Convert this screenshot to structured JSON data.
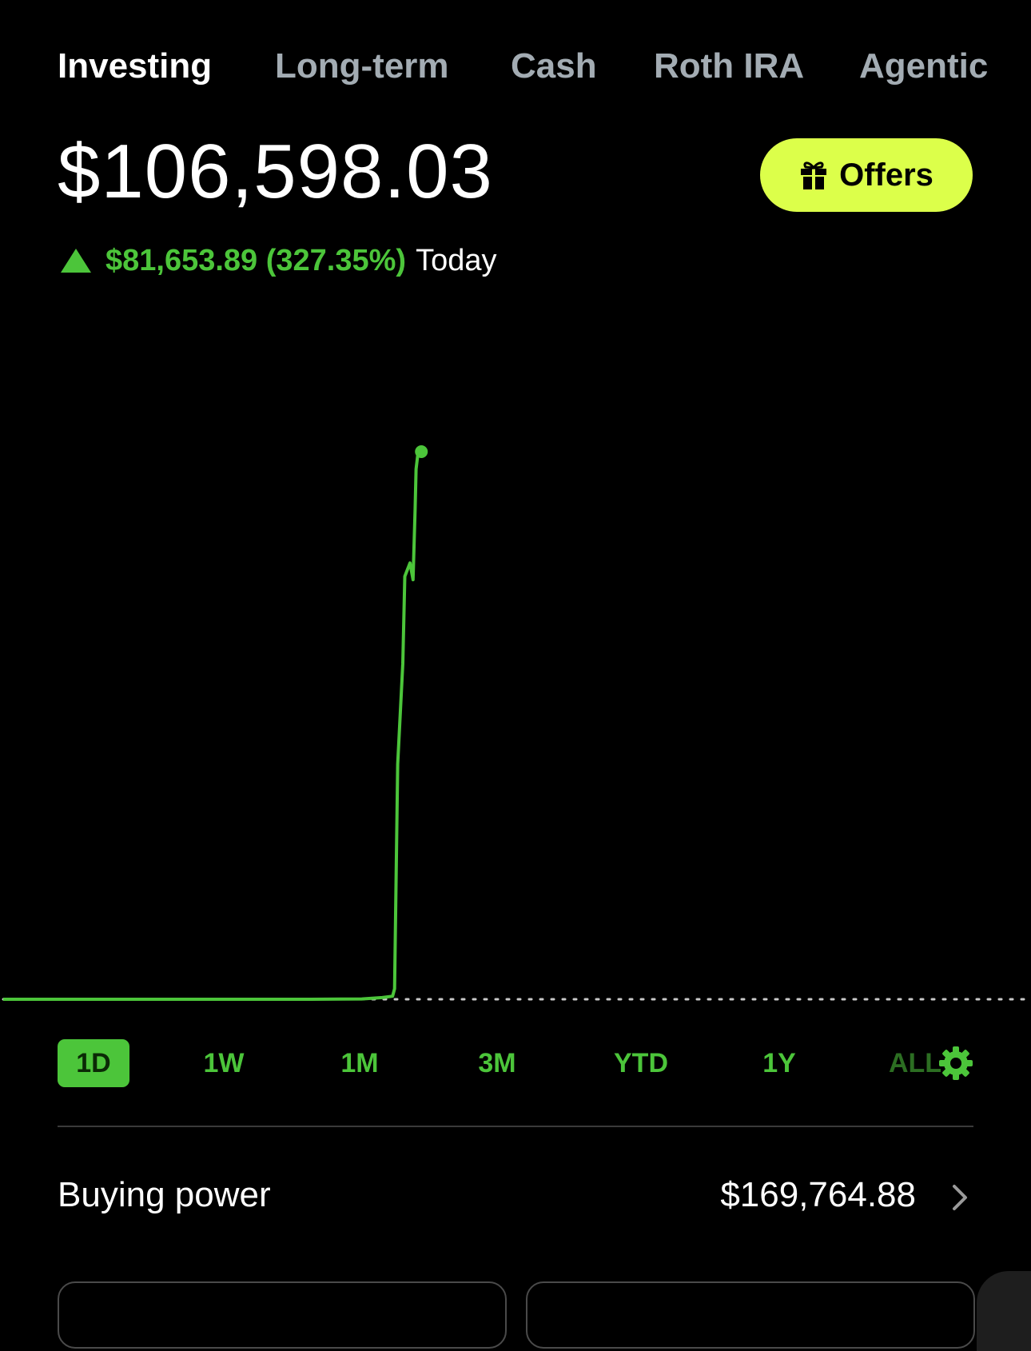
{
  "tabs": [
    {
      "label": "Investing",
      "active": true
    },
    {
      "label": "Long-term",
      "active": false
    },
    {
      "label": "Cash",
      "active": false
    },
    {
      "label": "Roth IRA",
      "active": false
    },
    {
      "label": "Agentic",
      "active": false
    }
  ],
  "portfolio": {
    "value": "$106,598.03",
    "change": "$81,653.89 (327.35%)",
    "period": "Today"
  },
  "offers_button": {
    "label": "Offers",
    "icon": "gift-icon",
    "color": "#dcff4a"
  },
  "colors": {
    "positive": "#4cc53a",
    "background": "#000000"
  },
  "chart_data": {
    "type": "line",
    "series": [
      {
        "x": [
          0,
          0.05,
          0.1,
          0.15,
          0.2,
          0.25,
          0.3,
          0.33,
          0.35,
          0.37,
          0.38,
          0.382,
          0.385,
          0.39,
          0.392,
          0.397,
          0.4,
          0.402,
          0.403,
          0.405
        ],
        "y": [
          24944.14,
          24940.0,
          24950.0,
          24946.0,
          24948.0,
          24945.0,
          24950.0,
          24975.0,
          24990.0,
          25200.0,
          25400.0,
          26500.0,
          60000.0,
          75000.0,
          88000.0,
          90000.0,
          87500.0,
          98000.0,
          104000.0,
          106598.03
        ]
      }
    ],
    "baseline": 24944.14,
    "x_fraction_of_day": true
  },
  "ranges": [
    {
      "label": "1D",
      "active": true
    },
    {
      "label": "1W",
      "active": false
    },
    {
      "label": "1M",
      "active": false
    },
    {
      "label": "3M",
      "active": false
    },
    {
      "label": "YTD",
      "active": false
    },
    {
      "label": "1Y",
      "active": false
    },
    {
      "label": "ALL",
      "active": false
    }
  ],
  "buying_power": {
    "label": "Buying power",
    "value": "$169,764.88"
  }
}
